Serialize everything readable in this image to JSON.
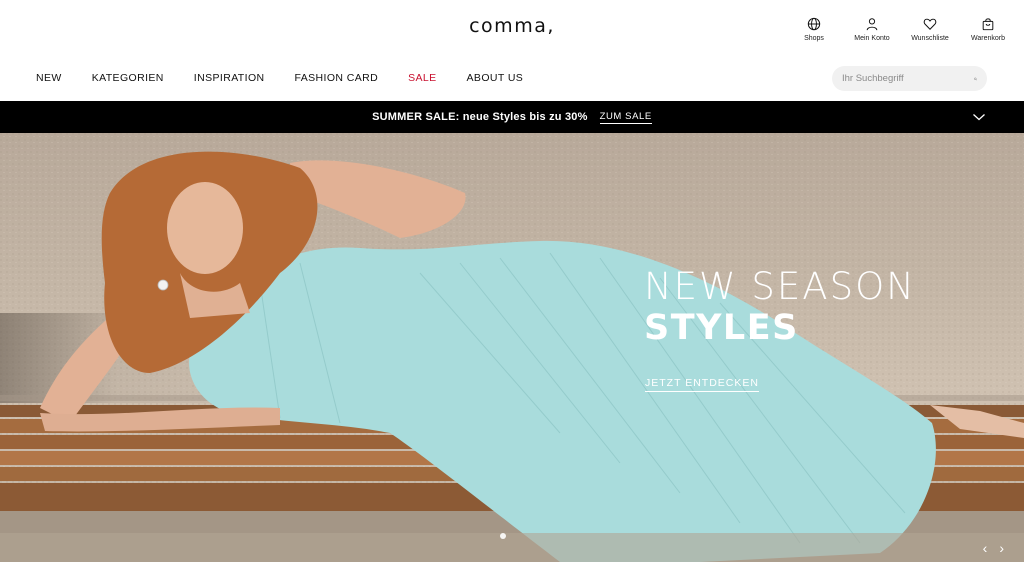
{
  "brand": {
    "logo": "comma,"
  },
  "utility": [
    {
      "name": "shops",
      "label": "Shops",
      "icon": "globe-icon"
    },
    {
      "name": "account",
      "label": "Mein Konto",
      "icon": "user-icon"
    },
    {
      "name": "wishlist",
      "label": "Wunschliste",
      "icon": "heart-icon"
    },
    {
      "name": "cart",
      "label": "Warenkorb",
      "icon": "bag-icon"
    }
  ],
  "nav": {
    "items": [
      "NEW",
      "KATEGORIEN",
      "INSPIRATION",
      "FASHION CARD",
      "SALE",
      "ABOUT US"
    ],
    "sale_color": "#c8102e"
  },
  "search": {
    "placeholder": "Ihr Suchbegriff",
    "value": ""
  },
  "promo": {
    "text": "SUMMER SALE: neue Styles bis zu 30%",
    "link": "ZUM SALE",
    "background": "#000000"
  },
  "hero": {
    "headline_line1": "NEW SEASON",
    "headline_line2": "STYLES",
    "cta": "JETZT ENTDECKEN",
    "prev": "‹",
    "next": "›",
    "dress_color": "#a9dcdc"
  }
}
